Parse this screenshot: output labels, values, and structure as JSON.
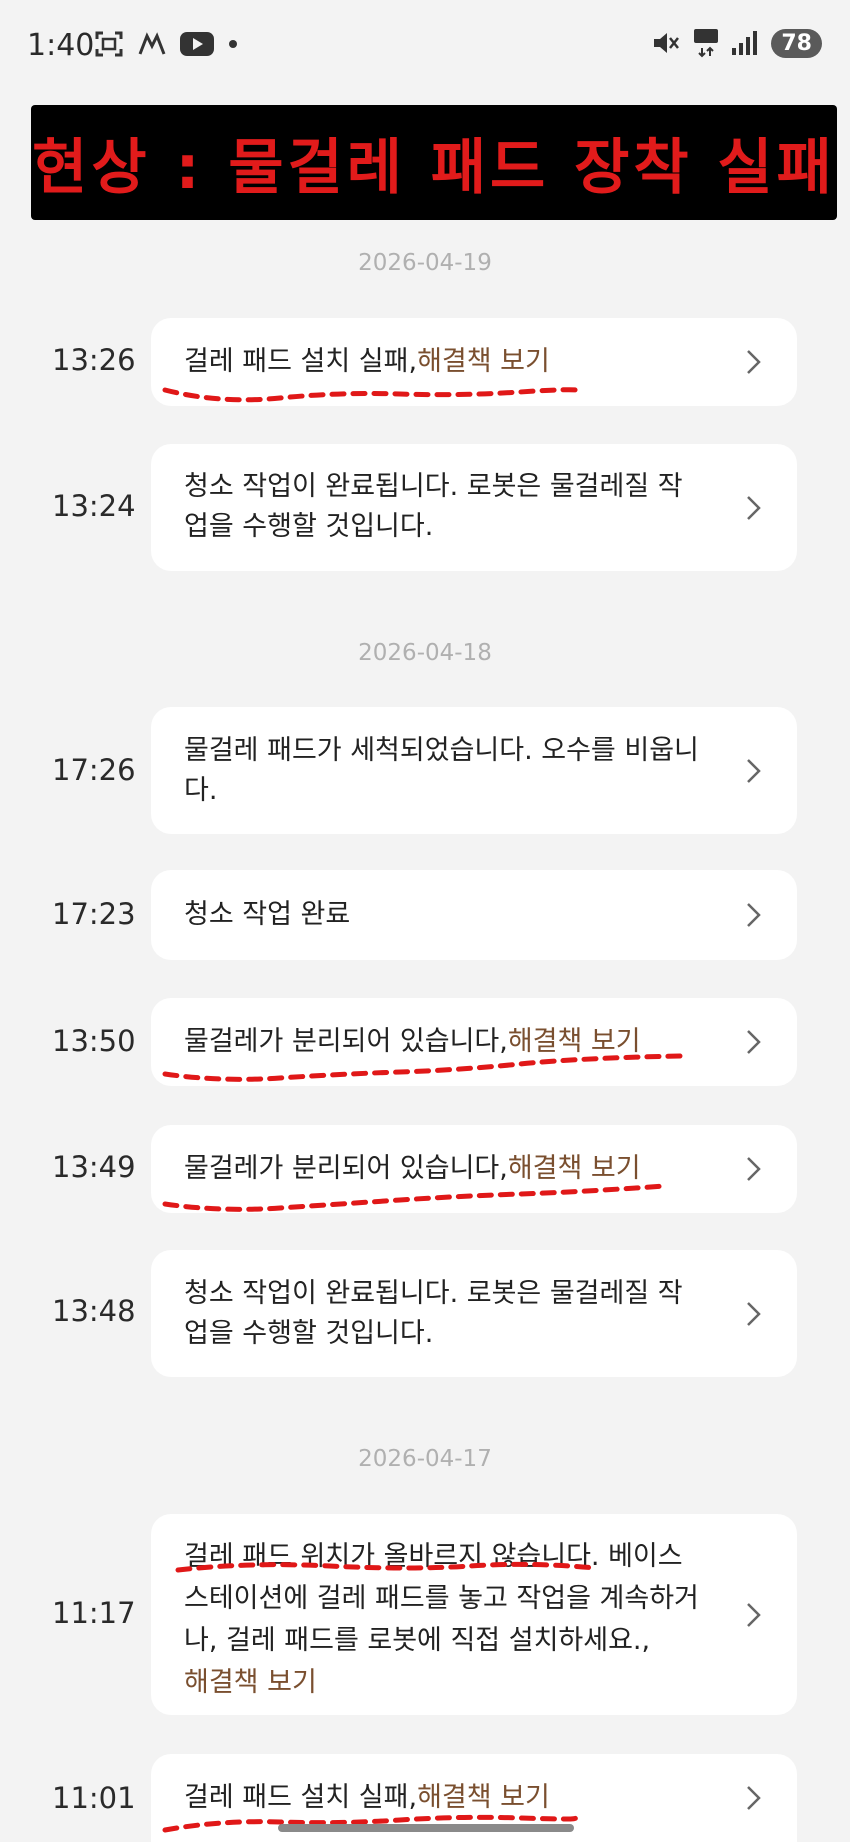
{
  "status_bar": {
    "time": "1:40",
    "battery": "78",
    "icons": [
      "screenshot-icon",
      "app-icon",
      "youtube-icon",
      "dot-icon",
      "mute-icon",
      "network-5g-icon",
      "signal-icon"
    ]
  },
  "banner": {
    "text": "현상 : 물걸레 패드 장착 실패",
    "color": "#e11b1b"
  },
  "accent": {
    "link_color": "#7a4f2f",
    "annotation_color": "#e01818"
  },
  "dates": [
    "2026-04-19",
    "2026-04-18",
    "2026-04-17"
  ],
  "items": [
    {
      "time": "13:26",
      "text": "걸레 패드 설치 실패,",
      "link": "해결책 보기"
    },
    {
      "time": "13:24",
      "text": "청소 작업이 완료됩니다. 로봇은 물걸레질 작업을 수행할 것입니다.",
      "link": ""
    },
    {
      "time": "17:26",
      "text": "물걸레 패드가 세척되었습니다. 오수를 비웁니다.",
      "link": ""
    },
    {
      "time": "17:23",
      "text": "청소 작업 완료",
      "link": ""
    },
    {
      "time": "13:50",
      "text": "물걸레가 분리되어 있습니다,",
      "link": "해결책 보기"
    },
    {
      "time": "13:49",
      "text": "물걸레가 분리되어 있습니다,",
      "link": "해결책 보기"
    },
    {
      "time": "13:48",
      "text": "청소 작업이 완료됩니다. 로봇은 물걸레질 작업을 수행할 것입니다.",
      "link": ""
    },
    {
      "time": "11:17",
      "text": "걸레 패드 위치가 올바르지 않습니다. 베이스 스테이션에 걸레 패드를 놓고 작업을 계속하거나, 걸레 패드를 로봇에 직접 설치하세요.,",
      "link": "해결책 보기"
    },
    {
      "time": "11:01",
      "text": "걸레 패드 설치 실패,",
      "link": "해결책 보기"
    }
  ]
}
